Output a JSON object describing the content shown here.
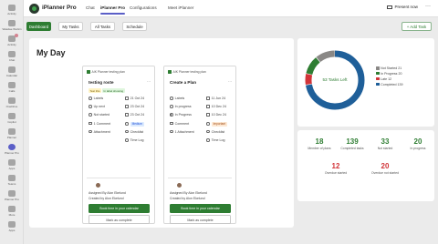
{
  "rail": [
    {
      "label": "Activity",
      "icon": "bell-icon",
      "badge": false
    },
    {
      "label": "Wasdae Workin",
      "icon": "grid-icon",
      "badge": false
    },
    {
      "label": "Activity",
      "icon": "bell-icon",
      "badge": true
    },
    {
      "label": "Chat",
      "icon": "chat-icon",
      "badge": false
    },
    {
      "label": "Calendar",
      "icon": "calendar-icon",
      "badge": false
    },
    {
      "label": "Calls",
      "icon": "phone-icon",
      "badge": false
    },
    {
      "label": "OneDrive",
      "icon": "cloud-icon",
      "badge": false
    },
    {
      "label": "Copilot",
      "icon": "copilot-icon",
      "badge": false
    },
    {
      "label": "Planner",
      "icon": "planner-icon",
      "badge": false
    },
    {
      "label": "Planner Pro",
      "icon": "planner-pro-icon",
      "badge": false,
      "active": true
    },
    {
      "label": "Apps",
      "icon": "apps-icon",
      "badge": false
    },
    {
      "label": "Teams",
      "icon": "teams-icon",
      "badge": false
    },
    {
      "label": "Planner Pro",
      "icon": "planner-pro-icon",
      "badge": false
    },
    {
      "label": "More",
      "icon": "ellipsis-icon",
      "badge": false
    },
    {
      "label": "Apps",
      "icon": "apps-icon",
      "badge": false
    }
  ],
  "header": {
    "app_name": "iPlanner Pro",
    "tabs": [
      "Chat",
      "iPlanner Pro",
      "Configurations",
      "Meet iPlanner"
    ],
    "active_tab": "iPlanner Pro",
    "present": "Present now",
    "more": "···"
  },
  "toolbar": {
    "buttons": [
      "Dashboard",
      "My Tasks",
      "All Tasks",
      "Schedule"
    ],
    "active": "Dashboard",
    "add_task": "+ Add Task"
  },
  "main": {
    "title": "My Day",
    "cards": [
      {
        "plan": "AIK Planner testing plan",
        "title": "testing roste",
        "more": "···",
        "tags": [
          "Test this",
          "In label showing"
        ],
        "labels": "Labels",
        "start": "21 Oct 24",
        "repeat": "Up next",
        "due": "23 Oct 24",
        "status": "Not started",
        "finish": "23 Oct 24",
        "comments": "1 Comment",
        "priority": "Medium",
        "attachments": "Attachment",
        "checklist": "Checklist",
        "time_log": "Time Log",
        "assigned": "Assigned By Alon Ekelund",
        "created": "Created by Alon Ekelund",
        "book": "Book time in your calendar",
        "mark": "Mark as complete"
      },
      {
        "plan": "AIK Planner testing plan",
        "title": "Create a Plan",
        "more": "···",
        "tags": [],
        "labels": "Labels",
        "start": "11 Jun 24",
        "repeat": "In progress",
        "due": "10 Dec 24",
        "status": "In Progress",
        "finish": "10 Dec 24",
        "comments": "Comment",
        "priority": "Important",
        "attachments": "1 Attachment",
        "checklist": "Checklist",
        "time_log": "Time Log",
        "assigned": "Assigned By Alon Ekelund",
        "created": "Created by Alon Ekelund",
        "book": "Book time in your calendar",
        "mark": "Mark as complete"
      }
    ]
  },
  "donut": {
    "center": "53 Tasks Left",
    "segments": [
      {
        "label": "Not Started 21",
        "color": "#8a8886",
        "value": 21
      },
      {
        "label": "In Progress 20",
        "color": "#2e7d32",
        "value": 20
      },
      {
        "label": "Late 12",
        "color": "#d13438",
        "value": 12
      },
      {
        "label": "Completed 139",
        "color": "#1f5f99",
        "value": 139
      }
    ]
  },
  "stats": [
    {
      "value": "18",
      "label": "Member of plans",
      "color": "green"
    },
    {
      "value": "139",
      "label": "Completed tasks",
      "color": "green"
    },
    {
      "value": "33",
      "label": "Not started",
      "color": "green"
    },
    {
      "value": "20",
      "label": "In progress",
      "color": "green"
    },
    {
      "value": "12",
      "label": "Overdue started",
      "color": "red"
    },
    {
      "value": "20",
      "label": "Overdue not started",
      "color": "red"
    }
  ]
}
